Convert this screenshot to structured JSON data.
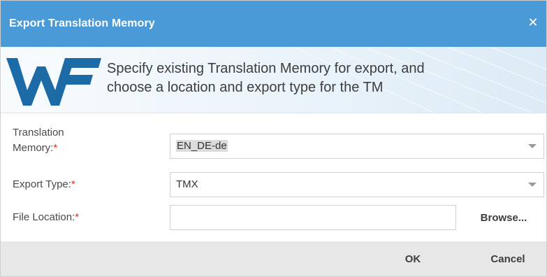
{
  "dialog": {
    "title": "Export Translation Memory",
    "close_icon": "close-icon"
  },
  "banner": {
    "logo_icon": "wordfast-logo-icon",
    "line1": "Specify existing Translation Memory for export, and",
    "line2": "choose a location and export type for the TM"
  },
  "form": {
    "tm_label_line1": "Translation",
    "tm_label_line2": "Memory:",
    "tm_value": "EN_DE-de",
    "export_type_label": "Export Type:",
    "export_type_value": "TMX",
    "file_location_label": "File Location:",
    "file_location_value": "",
    "required_mark": "*",
    "browse_label": "Browse..."
  },
  "footer": {
    "ok_label": "OK",
    "cancel_label": "Cancel"
  },
  "colors": {
    "titlebar": "#4a9ad7",
    "logo": "#1c6aa6",
    "required": "#d0312d",
    "footer": "#e7e7e7"
  }
}
